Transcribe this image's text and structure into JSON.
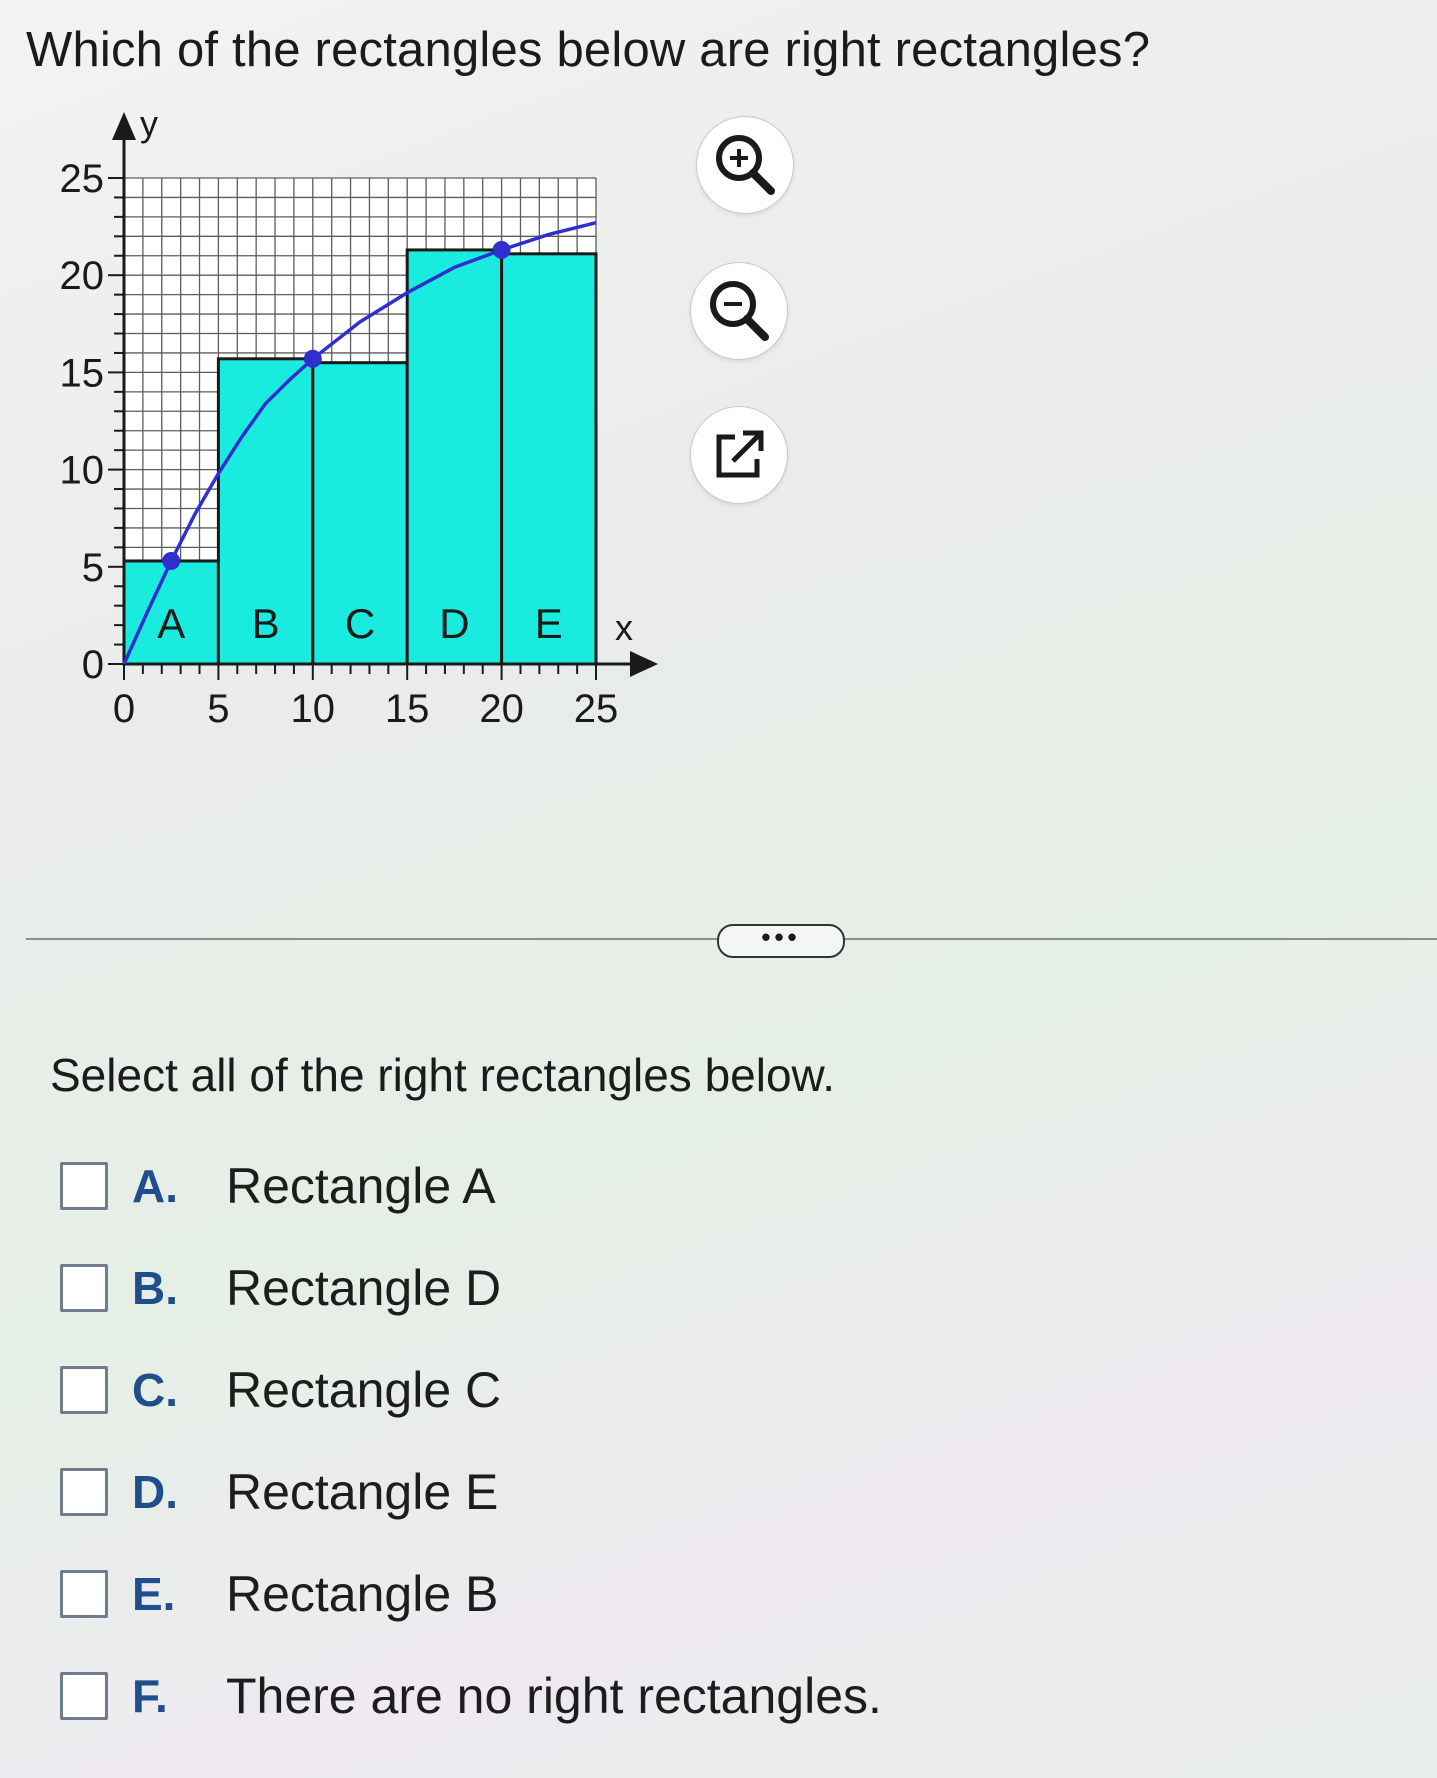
{
  "question": "Which of the rectangles below are right rectangles?",
  "toolbar": {
    "zoom_in_icon": "zoom-in-icon",
    "zoom_out_icon": "zoom-out-icon",
    "popout_icon": "popout-icon"
  },
  "chart_data": {
    "type": "rectangles-under-curve",
    "xlabel": "x",
    "ylabel": "y",
    "xlim": [
      0,
      25
    ],
    "ylim": [
      0,
      25
    ],
    "x_ticks": [
      0,
      5,
      10,
      15,
      20,
      25
    ],
    "y_ticks": [
      0,
      5,
      10,
      15,
      20,
      25
    ],
    "grid": true,
    "curve_color": "#2f2fd0",
    "rect_color": "#19ecdf",
    "rectangles": [
      {
        "label": "A",
        "x0": 0,
        "x1": 5,
        "height": 5.3
      },
      {
        "label": "B",
        "x0": 5,
        "x1": 10,
        "height": 15.7
      },
      {
        "label": "C",
        "x0": 10,
        "x1": 15,
        "height": 15.5
      },
      {
        "label": "D",
        "x0": 15,
        "x1": 20,
        "height": 21.3
      },
      {
        "label": "E",
        "x0": 20,
        "x1": 25,
        "height": 21.1
      }
    ],
    "marked_points": [
      {
        "x": 2.5,
        "y": 5.3
      },
      {
        "x": 10,
        "y": 15.7
      },
      {
        "x": 20,
        "y": 21.3
      }
    ],
    "curve": [
      [
        0,
        0
      ],
      [
        1.25,
        2.7
      ],
      [
        2.5,
        5.3
      ],
      [
        3.75,
        7.7
      ],
      [
        5,
        9.8
      ],
      [
        6.25,
        11.7
      ],
      [
        7.5,
        13.4
      ],
      [
        8.75,
        14.6
      ],
      [
        10,
        15.7
      ],
      [
        12.5,
        17.6
      ],
      [
        15,
        19.1
      ],
      [
        17.5,
        20.4
      ],
      [
        20,
        21.3
      ],
      [
        22.5,
        22.1
      ],
      [
        25,
        22.7
      ]
    ]
  },
  "more_label": "•••",
  "instruction": "Select all of the right rectangles below.",
  "options": [
    {
      "letter": "A.",
      "text": "Rectangle A"
    },
    {
      "letter": "B.",
      "text": "Rectangle D"
    },
    {
      "letter": "C.",
      "text": "Rectangle C"
    },
    {
      "letter": "D.",
      "text": "Rectangle E"
    },
    {
      "letter": "E.",
      "text": "Rectangle B"
    },
    {
      "letter": "F.",
      "text": "There are no right rectangles."
    }
  ]
}
